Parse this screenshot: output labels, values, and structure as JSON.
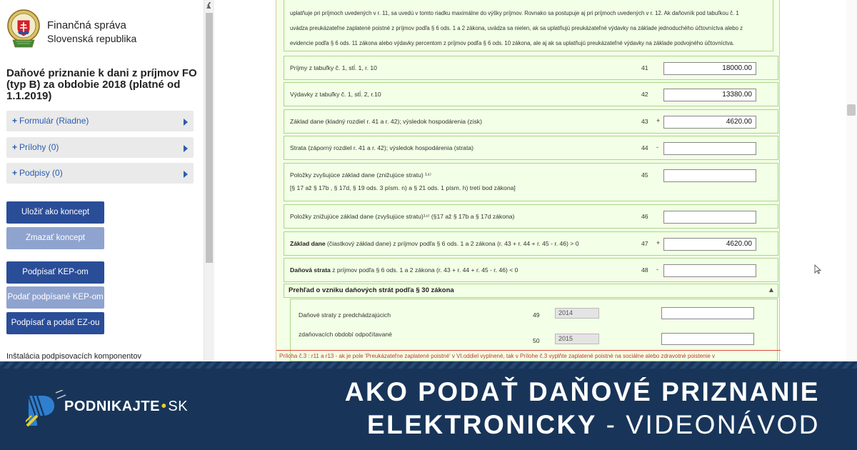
{
  "sidebar": {
    "org_name": "Finančná správa",
    "org_country": "Slovenská republika",
    "doc_title": "Daňové priznanie k dani z príjmov FO (typ B) za obdobie 2018 (platné od 1.1.2019)",
    "accordions": [
      {
        "label": "Formulár (Riadne)"
      },
      {
        "label": "Prílohy (0)"
      },
      {
        "label": "Podpisy (0)"
      }
    ],
    "buttons": {
      "save_draft": "Uložiť ako koncept",
      "delete_draft": "Zmazať koncept",
      "sign_kep": "Podpísať KEP-om",
      "submit_signed_kep": "Podať podpísané KEP-om",
      "sign_submit_ez": "Podpísať a podať EZ-ou"
    },
    "install_text": "Inštalácia podpisovacích komponentov"
  },
  "form": {
    "note_lines": [
      "uplatňuje pri príjmoch uvedených v r. 11, sa uvedú v tomto riadku maximálne do výšky príjmov. Rovnako sa postupuje aj pri príjmoch uvedených v r. 12. Ak daňovník pod tabuľkou č. 1",
      "uvádza preukázateľne zaplatené poistné z príjmov podľa § 6 ods. 1 a 2 zákona, uvádza sa nielen, ak sa uplatňujú preukázateľné výdavky na základe jednoduchého účtovníctva alebo z",
      "evidencie podľa § 6 ods. 11 zákona alebo výdavky percentom z príjmov podľa § 6 ods. 10 zákona, ale aj ak sa uplatňujú preukázateľné výdavky na základe podvojného účtovníctva."
    ],
    "rows": [
      {
        "label": "Príjmy z tabuľky č. 1, stĺ. 1, r. 10",
        "num": "41",
        "sign": "",
        "value": "18000.00"
      },
      {
        "label": "Výdavky z tabuľky č. 1, stĺ. 2, r.10",
        "num": "42",
        "sign": "",
        "value": "13380.00"
      },
      {
        "label": "Základ dane (kladný rozdiel r. 41 a r. 42); výsledok hospodárenia (zisk)",
        "num": "43",
        "sign": "+",
        "value": "4620.00"
      },
      {
        "label": "Strata (záporný rozdiel r. 41 a r. 42); výsledok hospodárenia (strata)",
        "num": "44",
        "sign": "-",
        "value": ""
      },
      {
        "label": "Položky zvyšujúce základ dane (znižujúce stratu) ¹⁴⁾",
        "label2": "[§ 17 až § 17b , § 17d, § 19 ods. 3 písm. n) a § 21 ods. 1 písm. h) tretí bod zákona]",
        "num": "45",
        "sign": "",
        "value": ""
      },
      {
        "label": "Položky znižujúce základ dane (zvyšujúce stratu)¹⁴⁾ (§17 až § 17b a § 17d zákona)",
        "num": "46",
        "sign": "",
        "value": ""
      },
      {
        "label_bold": "Základ dane",
        "label": " (čiastkový základ dane) z príjmov podľa § 6 ods. 1 a 2 zákona (r. 43 + r. 44 + r. 45 - r. 46) > 0",
        "num": "47",
        "sign": "+",
        "value": "4620.00"
      },
      {
        "label_bold": "Daňová strata",
        "label": " z príjmov podľa § 6 ods. 1 a 2 zákona (r. 43 + r. 44 + r. 45 - r. 46) < 0",
        "num": "48",
        "sign": "-",
        "value": ""
      }
    ],
    "section_title": "Prehľad o vzniku daňových strát podľa § 30 zákona",
    "loss_label_1": "Daňové straty z predchádzajúcich",
    "loss_label_2": "zdaňovacích období odpočítavané",
    "loss_rows": [
      {
        "num": "49",
        "year": "2014"
      },
      {
        "num": "50",
        "year": "2015"
      }
    ],
    "error_text": "Príloha č.3 : r11 a r13 - ak je pole 'Preukázateľne zaplatené poistné' v VI.oddiel vyplnené, tak v Prílohe č.3 vyplňte zaplatené poistné na sociálne alebo zdravotné poistenie v"
  },
  "banner": {
    "brand": "PODNIKAJTE",
    "brand_dot": "•",
    "brand_tld": "SK",
    "headline_line1": "AKO PODAŤ DAŇOVÉ PRIZNANIE",
    "headline_line2_bold": "ELEKTRONICKY",
    "headline_line2_thin": " - VIDEONÁVOD",
    "colors": {
      "background": "#183559",
      "accent_yellow": "#f0d020",
      "accent_blue": "#2f7fd1"
    }
  }
}
